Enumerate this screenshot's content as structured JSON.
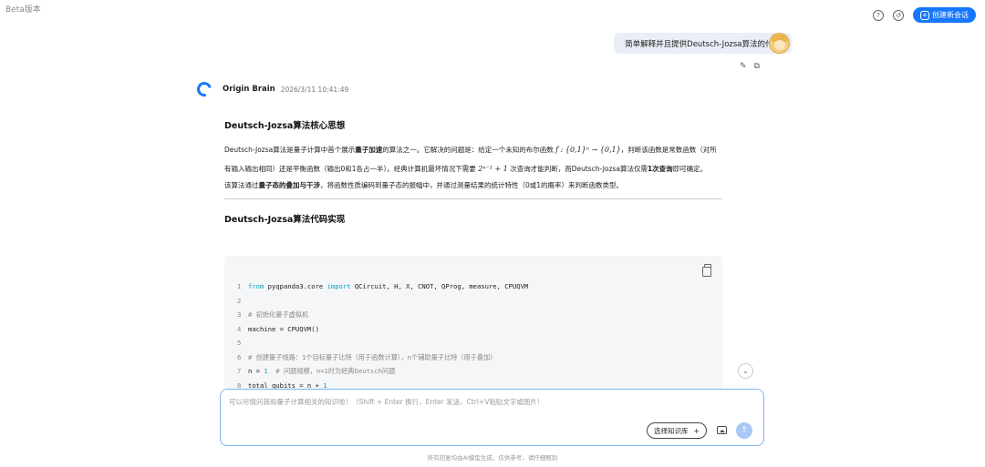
{
  "header": {
    "beta_label": "Beta版本",
    "help_icon": "?",
    "history_icon": "↺",
    "new_chat_label": "创建新会话"
  },
  "user_message": {
    "text": "简单解释并且提供Deutsch-Jozsa算法的代码",
    "edit_icon": "✎",
    "copy_icon": "⧉"
  },
  "bot": {
    "name": "Origin Brain",
    "timestamp": "2026/3/11 10:41:49"
  },
  "answer": {
    "section1_title": "Deutsch-Jozsa算法核心思想",
    "p1_a": "Deutsch-Jozsa算法是量子计算中首个展示",
    "p1_bold": "量子加速",
    "p1_b": "的算法之一。它解决的问题是：给定一个未知的布尔函数 ",
    "p1_math1": "f : {0,1}ⁿ → {0,1}",
    "p1_c": "，判断该函数是常数函数（对所有输入输出相同）还是平衡函数（输出0和1各占一半）。经典计算机最坏情况下需要 ",
    "p1_math2": "2ⁿ⁻¹ + 1",
    "p1_d": " 次查询才能判断，而Deutsch-Jozsa算法仅需",
    "p1_bold2": "1次查询",
    "p1_e": "即可确定。",
    "p2_a": "该算法通过",
    "p2_bold": "量子态的叠加与干涉",
    "p2_b": "，将函数性质编码到量子态的振幅中，并通过测量结果的统计特性（0或1的概率）来判断函数类型。",
    "section2_title": "Deutsch-Jozsa算法代码实现"
  },
  "code": [
    {
      "n": "1",
      "kw1": "from",
      "t1": " pyqpanda3.core ",
      "kw2": "import",
      "t2": " QCircuit, H, X, CNOT, QProg, measure, CPUQVM",
      "cm": ""
    },
    {
      "n": "2",
      "kw1": "",
      "t1": "",
      "kw2": "",
      "t2": "",
      "cm": ""
    },
    {
      "n": "3",
      "kw1": "",
      "t1": "",
      "kw2": "",
      "t2": "",
      "cm": "# 初始化量子虚拟机"
    },
    {
      "n": "4",
      "kw1": "",
      "t1": "machine = CPUQVM()",
      "kw2": "",
      "t2": "",
      "cm": ""
    },
    {
      "n": "5",
      "kw1": "",
      "t1": "",
      "kw2": "",
      "t2": "",
      "cm": ""
    },
    {
      "n": "6",
      "kw1": "",
      "t1": "",
      "kw2": "",
      "t2": "",
      "cm": "# 创建量子线路：1个目标量子比特（用于函数计算），n个辅助量子比特（用于叠加）"
    },
    {
      "n": "7",
      "kw1": "",
      "t1": "n = ",
      "kw2": "1",
      "t2": "  ",
      "cm": "# 问题规模，n=1时为经典Deutsch问题"
    },
    {
      "n": "8",
      "kw1": "",
      "t1": "total_qubits = n + ",
      "kw2": "1",
      "t2": "",
      "cm": ""
    }
  ],
  "composer": {
    "placeholder": "可以尽情问我和量子计算相关的知识啦！（Shift + Enter 换行，Enter 发送，Ctrl+V粘贴文字或图片）",
    "knowledge_base_label": "选择知识库",
    "kb_plus": "+",
    "send_icon": "↑"
  },
  "scroll_down_icon": "⌄",
  "footer_note": "所有回复均由AI模型生成，仅供参考。请仔细甄别"
}
